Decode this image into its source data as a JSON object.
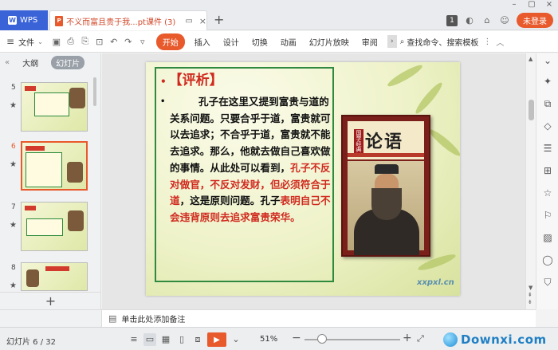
{
  "titlebar": {
    "wps_tab": "WPS",
    "doc_tab_title": "不义而富且贵于我...pt课件 (3)",
    "badge": "1",
    "login_label": "未登录"
  },
  "menubar": {
    "file_label": "文件",
    "tabs": [
      "开始",
      "插入",
      "设计",
      "切换",
      "动画",
      "幻灯片放映",
      "审阅"
    ],
    "search_label": "查找命令、搜索模板"
  },
  "leftpanel": {
    "tab_outline": "大纲",
    "tab_slides": "幻灯片",
    "thumbnails": [
      {
        "num": "5"
      },
      {
        "num": "6"
      },
      {
        "num": "7"
      },
      {
        "num": "8"
      }
    ],
    "selected_index": 1
  },
  "slide": {
    "heading": "【评析】",
    "bullet_char": "•",
    "body_black_1": "孔子在这里又提到富贵与道的关系问题。只要合乎于道，富贵就可以去追求；不合乎于道，富贵就不能去追求。那么，他就去做自己喜欢做的事情。从此处可以看到，",
    "body_red_1": "孔子不反对做官，不反对发财，但必须符合于道",
    "body_black_2": "，这是原则问题。孔子",
    "body_red_2": "表明自己不会违背原则去追求富贵荣华。",
    "book_title": "论语",
    "book_side": "国学经典",
    "watermark": "xxpxl.cn"
  },
  "notes": {
    "placeholder": "单击此处添加备注"
  },
  "status": {
    "slide_counter": "幻灯片 6 / 32",
    "zoom": "51%",
    "zoom_level": 0.51,
    "brand": "Downxi.com"
  },
  "colors": {
    "accent": "#e8592c",
    "wps_blue": "#3a63d8",
    "slide_red": "#d02a1f",
    "slide_green": "#2f8a3f"
  }
}
